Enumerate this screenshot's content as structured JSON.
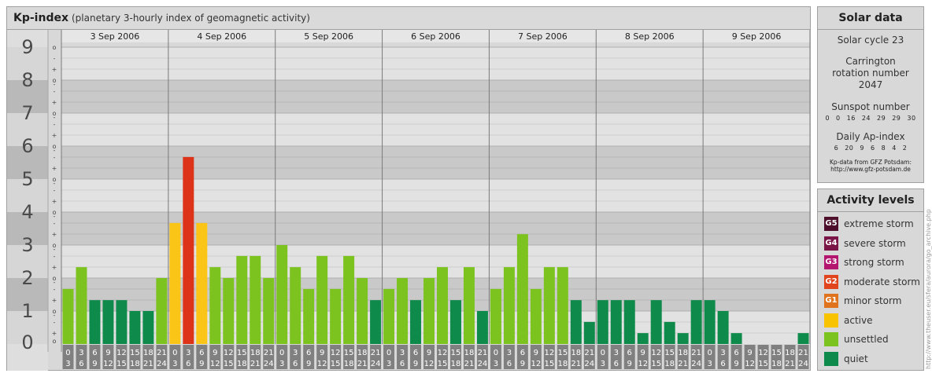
{
  "header": {
    "title": "Kp-index",
    "subtitle": "(planetary 3-hourly index of geomagnetic activity)"
  },
  "chart_data": {
    "type": "bar",
    "title": "Kp-index",
    "subtitle": "(planetary 3-hourly index of geomagnetic activity)",
    "ylim": [
      0,
      9
    ],
    "y_ticks": [
      "0",
      "1",
      "2",
      "3",
      "4",
      "5",
      "6",
      "7",
      "8",
      "9"
    ],
    "minor_ticks": [
      "-",
      "o",
      "+"
    ],
    "days": [
      "3 Sep 2006",
      "4 Sep 2006",
      "5 Sep 2006",
      "6 Sep 2006",
      "7 Sep 2006",
      "8 Sep 2006",
      "9 Sep 2006"
    ],
    "hour_ranges": [
      [
        "0",
        "3"
      ],
      [
        "3",
        "6"
      ],
      [
        "6",
        "9"
      ],
      [
        "9",
        "12"
      ],
      [
        "12",
        "15"
      ],
      [
        "15",
        "18"
      ],
      [
        "18",
        "21"
      ],
      [
        "21",
        "24"
      ]
    ],
    "values": [
      [
        1.67,
        2.33,
        1.33,
        1.33,
        1.33,
        1.0,
        1.0,
        2.0
      ],
      [
        3.67,
        5.67,
        3.67,
        2.33,
        2.0,
        2.67,
        2.67,
        2.0
      ],
      [
        3.0,
        2.33,
        1.67,
        2.67,
        1.67,
        2.67,
        2.0,
        1.33
      ],
      [
        1.67,
        2.0,
        1.33,
        2.0,
        2.33,
        1.33,
        2.33,
        1.0
      ],
      [
        1.67,
        2.33,
        3.33,
        1.67,
        2.33,
        2.33,
        1.33,
        0.67
      ],
      [
        1.33,
        1.33,
        1.33,
        0.33,
        1.33,
        0.67,
        0.33,
        1.33
      ],
      [
        1.33,
        1.0,
        0.33,
        0.0,
        0.0,
        0.0,
        0.0,
        0.33
      ]
    ]
  },
  "colors": {
    "extreme": "#4d0f2c",
    "severe": "#7a1547",
    "strong": "#b3156f",
    "moderate": "#e0451e",
    "minor": "#e0741e",
    "active": "#f8c300",
    "unsettled": "#7cc31f",
    "quiet": "#0e8a4a",
    "high_storm_bar": "#dd3318",
    "active_bar": "#fac517"
  },
  "solar": {
    "title": "Solar data",
    "cycle": "Solar cycle 23",
    "carrington": "Carrington rotation number 2047",
    "sunspot_label": "Sunspot number",
    "sunspot_values": [
      "0",
      "0",
      "16",
      "24",
      "29",
      "29",
      "30"
    ],
    "ap_label": "Daily Ap-index",
    "ap_values": [
      "6",
      "20",
      "9",
      "6",
      "8",
      "4",
      "2"
    ],
    "source_line1": "Kp-data from GFZ Potsdam:",
    "source_line2": "http://www.gfz-potsdam.de"
  },
  "activity": {
    "title": "Activity levels",
    "levels": [
      {
        "code": "G5",
        "label": "extreme storm",
        "color": "#4d0f2c"
      },
      {
        "code": "G4",
        "label": "severe storm",
        "color": "#7a1547"
      },
      {
        "code": "G3",
        "label": "strong storm",
        "color": "#b3156f"
      },
      {
        "code": "G2",
        "label": "moderate storm",
        "color": "#e0451e"
      },
      {
        "code": "G1",
        "label": "minor storm",
        "color": "#e0741e"
      },
      {
        "code": "",
        "label": "active",
        "color": "#f8c300"
      },
      {
        "code": "",
        "label": "unsettled",
        "color": "#7cc31f"
      },
      {
        "code": "",
        "label": "quiet",
        "color": "#0e8a4a"
      }
    ]
  },
  "credit": "http://www.theuser.eu/sfera/aurora/go_archive.php"
}
